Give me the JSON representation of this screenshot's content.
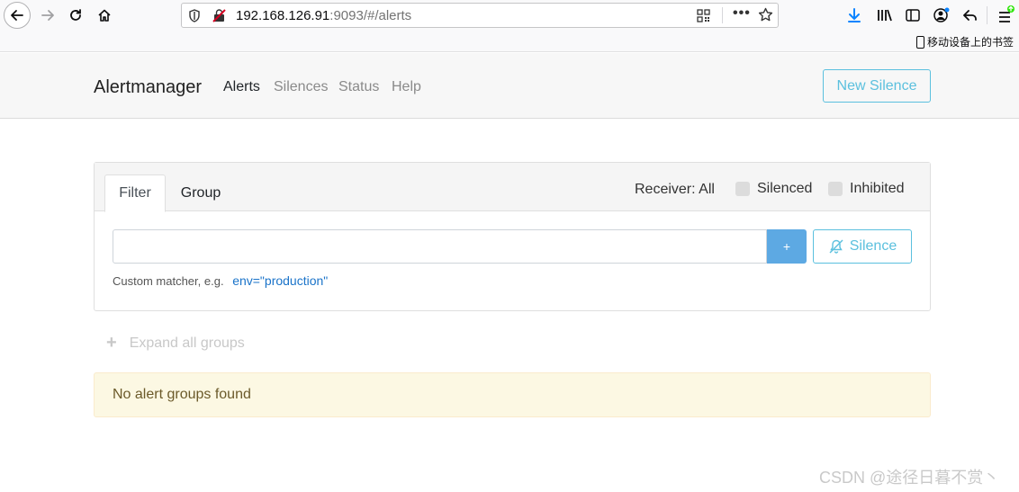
{
  "browser": {
    "url_host": "192.168.126.91",
    "url_rest": ":9093/#/alerts",
    "bookmarks_label": "移动设备上的书签"
  },
  "navbar": {
    "brand": "Alertmanager",
    "links": [
      "Alerts",
      "Silences",
      "Status",
      "Help"
    ],
    "new_silence_label": "New Silence"
  },
  "filter_card": {
    "tabs": [
      "Filter",
      "Group"
    ],
    "receiver_label": "Receiver: All",
    "silenced_label": "Silenced",
    "inhibited_label": "Inhibited",
    "input_value": "",
    "add_label": "+",
    "silence_label": "Silence",
    "hint_text": "Custom matcher, e.g.",
    "hint_example": "env=\"production\""
  },
  "expand_groups_label": "Expand all groups",
  "no_alerts_message": "No alert groups found",
  "watermark": "CSDN @途径日暮不赏丶",
  "colors": {
    "accent_info": "#5bc0de",
    "add_button": "#5da9e3",
    "warning_bg": "#fcf8e3"
  }
}
